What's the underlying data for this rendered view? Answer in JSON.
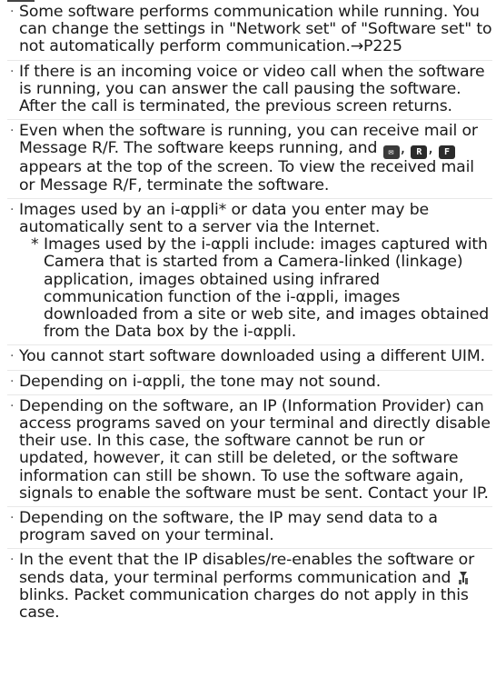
{
  "items": [
    {
      "text": "Some software performs communication while running. You can change the settings in \"Network set\" of \"Software set\" to not automatically perform communication.→P225"
    },
    {
      "text": "If there is an incoming voice or video call when the software is running, you can answer the call pausing the software. After the call is terminated, the previous screen returns."
    },
    {
      "text_a": "Even when the software is running, you can receive mail or Message R/F. The software keeps running, and ",
      "sep1": ", ",
      "sep2": ", ",
      "text_b": " appears at the top of the screen. To view the received mail or Message R/F, terminate the software.",
      "icons": [
        "mail-icon",
        "message-r-icon",
        "message-f-icon"
      ],
      "icon_labels": [
        "✉",
        "R",
        "F"
      ]
    },
    {
      "text": "Images used by an i-αppli* or data you enter may be automatically sent to a server via the Internet.",
      "note_marker": "*",
      "note": "Images used by the i-αppli include: images captured with Camera that is started from a Camera-linked (linkage) application, images obtained using infrared communication function of the i-αppli, images downloaded from a site or web site, and images obtained from the Data box by the i-αppli."
    },
    {
      "text": "You cannot start software downloaded using a different UIM."
    },
    {
      "text": "Depending on i-αppli, the tone may not sound."
    },
    {
      "text": "Depending on the software, an IP (Information Provider) can access programs saved on your terminal and directly disable their use. In this case, the software cannot be run or updated, however, it can still be deleted, or the software information can still be shown. To use the software again, signals to enable the software must be sent. Contact your IP."
    },
    {
      "text": "Depending on the software, the IP may send data to a program saved on your terminal."
    },
    {
      "text_a": "In the event that the IP disables/re-enables the software or sends data, your terminal performs communication and ",
      "text_b": " blinks. Packet communication charges do not apply in this case.",
      "icon": "packet-communication-icon"
    }
  ],
  "bullet": "·"
}
